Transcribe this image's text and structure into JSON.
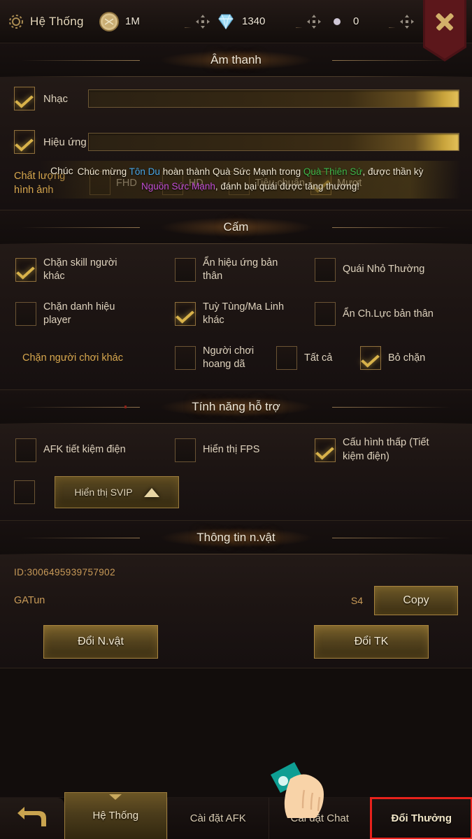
{
  "topbar": {
    "system_label": "Hệ Thống",
    "gear_icon": "gear-icon",
    "close_icon": "close-x-icon",
    "currencies": [
      {
        "icon": "coin-icon",
        "value": "1M",
        "plus_icon": "plus-icon"
      },
      {
        "icon": "diamond-icon",
        "value": "1340",
        "plus_icon": "plus-icon"
      },
      {
        "icon": "emblem-icon",
        "value": "0",
        "plus_icon": "plus-icon"
      }
    ]
  },
  "sections": {
    "audio": {
      "title": "Âm thanh",
      "music": {
        "label": "Nhạc",
        "checked": true,
        "value": 93
      },
      "effects": {
        "label": "Hiệu ứng",
        "checked": true,
        "value": 93
      },
      "quality": {
        "title_line1": "Chất lượng",
        "title_line2": "hình ảnh",
        "options": [
          {
            "label": "FHD",
            "checked": false
          },
          {
            "label": "HD",
            "checked": false
          },
          {
            "label": "Tiêu chuẩn",
            "checked": false
          },
          {
            "label": "Mượt",
            "checked": true
          }
        ]
      }
    },
    "block": {
      "title": "Cấm",
      "rows": [
        [
          {
            "label": "Chặn skill người khác",
            "checked": true
          },
          {
            "label": "Ẩn hiệu ứng bản thân",
            "checked": false
          },
          {
            "label": "Quái Nhỏ Thường",
            "checked": false
          }
        ],
        [
          {
            "label": "Chặn danh hiệu player",
            "checked": false
          },
          {
            "label": "Tuỳ Tùng/Ma Linh khác",
            "checked": true
          },
          {
            "label": "Ẩn Ch.Lực bản thân",
            "checked": false
          }
        ]
      ],
      "block_players": {
        "title": "Chặn người chơi khác",
        "options": [
          {
            "label": "Người chơi hoang dã",
            "checked": false
          },
          {
            "label": "Tất cả",
            "checked": false
          },
          {
            "label": "Bỏ chặn",
            "checked": true
          }
        ]
      }
    },
    "support": {
      "title": "Tính năng hỗ trợ",
      "rows": [
        [
          {
            "label": "AFK tiết kiệm điện",
            "checked": false
          },
          {
            "label": "Hiển thị FPS",
            "checked": false
          },
          {
            "label": "Cấu hình thấp (Tiết kiệm điện)",
            "checked": true
          }
        ]
      ],
      "svip": {
        "checked": false,
        "label": "Hiển thị SVIP",
        "arrow_icon": "chevron-up-icon"
      }
    },
    "character": {
      "title": "Thông tin n.vật",
      "id": "ID:3006495939757902",
      "name": "GATun",
      "server": "S4",
      "copy_label": "Copy",
      "change_char_label": "Đổi N.vật",
      "change_account_label": "Đổi TK"
    }
  },
  "broadcast": {
    "overlap_text": "Chúc",
    "parts": [
      {
        "text": "Chúc mừng ",
        "color": "w"
      },
      {
        "text": "Tôn Du",
        "color": "blue"
      },
      {
        "text": " hoàn thành Quà Sức Mạnh trong ",
        "color": "w"
      },
      {
        "text": "Quà Thiên Sứ",
        "color": "green"
      },
      {
        "text": ", được thần kỳ ",
        "color": "w"
      }
    ],
    "line2_parts": [
      {
        "text": "Nguồn Sức Mạnh",
        "color": "purple"
      },
      {
        "text": ", đánh bại quái được tăng thương!",
        "color": "w"
      }
    ],
    "line1_text": "Chúc mừng Tôn Du hoàn thành Quà Sức Mạnh trong Quà Thiên Sứ, được thần kỳ",
    "line2_text": "Nguồn Sức Mạnh, đánh bại quái được tăng thương!"
  },
  "bottomnav": {
    "back_icon": "back-arrow-icon",
    "tabs": [
      {
        "label": "Hệ Thống",
        "active": true,
        "highlight": false
      },
      {
        "label": "Cài đặt AFK",
        "active": false,
        "highlight": false
      },
      {
        "label": "Cài đặt Chat",
        "active": false,
        "highlight": false
      },
      {
        "label": "Đổi Thưởng",
        "active": false,
        "highlight": true
      }
    ]
  },
  "colors": {
    "gold": "#d8a84e",
    "check": "#d8b24a",
    "highlight_red": "#e8221c",
    "panel_bg": "#231a17"
  }
}
